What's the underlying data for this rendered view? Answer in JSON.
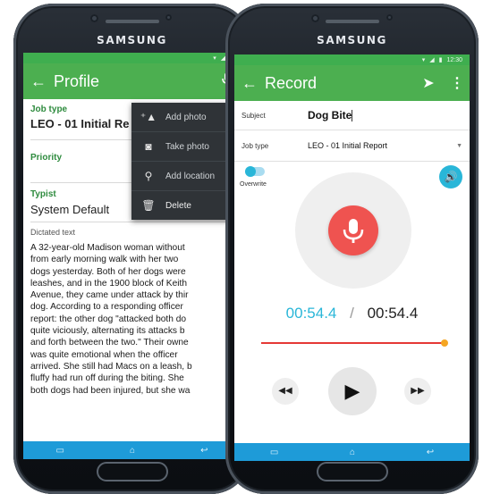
{
  "device_left": {
    "brand": "SAMSUNG"
  },
  "device_right": {
    "brand": "SAMSUNG"
  },
  "profile": {
    "title": "Profile",
    "job_type_label": "Job type",
    "job_type_value": "LEO - 01 Initial Re",
    "priority_label": "Priority",
    "typist_label": "Typist",
    "typist_value": "System Default",
    "dictated_label": "Dictated text",
    "dictated_lines": [
      "A 32-year-old Madison woman without",
      "from early morning walk with her two",
      "dogs yesterday. Both of her dogs were",
      "leashes, and in the 1900 block of Keith",
      "Avenue, they came under attack by thir",
      "dog. According to a responding officer",
      "report: the other dog \"attacked both do",
      "quite viciously, alternating its attacks b",
      "and forth between the two.\" Their owne",
      "was quite emotional when the officer",
      "arrived. She still had Macs on a leash, b",
      "fluffy had run off during the biting. She",
      "both dogs had been injured, but she wa"
    ],
    "menu": [
      {
        "icon": "add-photo-icon",
        "label": "Add photo"
      },
      {
        "icon": "camera-icon",
        "label": "Take photo"
      },
      {
        "icon": "location-icon",
        "label": "Add location"
      },
      {
        "icon": "trash-icon",
        "label": "Delete"
      }
    ]
  },
  "record": {
    "title": "Record",
    "status_time": "12:30",
    "subject_label": "Subject",
    "subject_value": "Dog Bite",
    "job_type_label": "Job type",
    "job_type_value": "LEO - 01 Initial Report",
    "overwrite_label": "Overwrite",
    "elapsed": "00:54.4",
    "separator": "/",
    "total": "00:54.4",
    "progress": 1.0
  },
  "colors": {
    "green": "#4caf50",
    "blue_nav": "#1e9bd8",
    "record_red": "#ef5350",
    "teal": "#29b6d8",
    "progress_red": "#e53935",
    "progress_knob": "#f5a623"
  }
}
